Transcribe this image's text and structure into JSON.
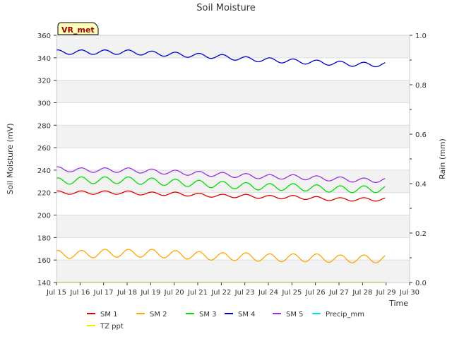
{
  "chart_data": {
    "type": "line",
    "title": "Soil Moisture",
    "site_label": "VR_met",
    "xlabel": "Time",
    "ylabel_left": "Soil Moisture (mV)",
    "ylabel_right": "Rain (mm)",
    "x_range_days": [
      15,
      30
    ],
    "ylim_left": [
      140,
      360
    ],
    "ylim_right": [
      0.0,
      1.0
    ],
    "left_ticks": [
      "140",
      "160",
      "180",
      "200",
      "220",
      "240",
      "260",
      "280",
      "300",
      "320",
      "340",
      "360"
    ],
    "right_ticks": [
      "0.0",
      "0.2",
      "0.4",
      "0.6",
      "0.8",
      "1.0"
    ],
    "x_ticks": [
      "Jul 15",
      "Jul 16",
      "Jul 17",
      "Jul 18",
      "Jul 19",
      "Jul 20",
      "Jul 21",
      "Jul 22",
      "Jul 23",
      "Jul 24",
      "Jul 25",
      "Jul 26",
      "Jul 27",
      "Jul 28",
      "Jul 29",
      "Jul 30"
    ],
    "series": [
      {
        "name": "SM 1",
        "color": "#dd0000",
        "axis": "left",
        "x": [
          15,
          16,
          17,
          18,
          19,
          20,
          21,
          22,
          23,
          24,
          25,
          26,
          27,
          28,
          29
        ],
        "values": [
          220,
          220,
          220,
          220,
          219,
          219,
          218,
          217,
          217,
          216,
          216,
          215,
          214,
          214,
          214
        ]
      },
      {
        "name": "SM 2",
        "color": "#ffa500",
        "axis": "left",
        "x": [
          15,
          16,
          17,
          18,
          19,
          20,
          21,
          22,
          23,
          24,
          25,
          26,
          27,
          28,
          29
        ],
        "values": [
          165,
          165,
          166,
          166,
          166,
          165,
          164,
          163,
          163,
          162,
          162,
          162,
          161,
          161,
          161
        ]
      },
      {
        "name": "SM 3",
        "color": "#00dd00",
        "axis": "left",
        "x": [
          15,
          16,
          17,
          18,
          19,
          20,
          21,
          22,
          23,
          24,
          25,
          26,
          27,
          28,
          29
        ],
        "values": [
          230,
          231,
          231,
          231,
          230,
          229,
          228,
          227,
          226,
          225,
          225,
          224,
          223,
          223,
          223
        ]
      },
      {
        "name": "SM 4",
        "color": "#0000cc",
        "axis": "left",
        "x": [
          15,
          16,
          17,
          18,
          19,
          20,
          21,
          22,
          23,
          24,
          25,
          26,
          27,
          28,
          29
        ],
        "values": [
          345,
          345,
          345,
          345,
          344,
          343,
          342,
          341,
          339,
          338,
          337,
          336,
          335,
          334,
          334
        ]
      },
      {
        "name": "SM 5",
        "color": "#9933dd",
        "axis": "left",
        "x": [
          15,
          16,
          17,
          18,
          19,
          20,
          21,
          22,
          23,
          24,
          25,
          26,
          27,
          28,
          29
        ],
        "values": [
          241,
          240,
          240,
          240,
          239,
          238,
          237,
          236,
          235,
          234,
          234,
          233,
          232,
          231,
          231
        ]
      },
      {
        "name": "Precip_mm",
        "color": "#00e5e5",
        "axis": "right",
        "x": [
          15,
          29
        ],
        "values": [
          0.0,
          0.0
        ]
      },
      {
        "name": "TZ ppt",
        "color": "#eeee00",
        "axis": "right",
        "x": [
          15,
          29
        ],
        "values": [
          0.0,
          0.0
        ]
      }
    ],
    "grid": true,
    "legend_position": "bottom"
  }
}
